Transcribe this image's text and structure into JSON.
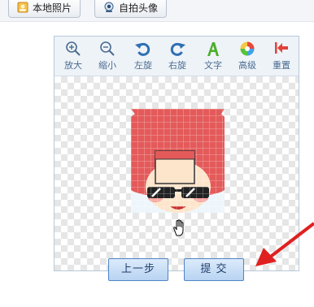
{
  "tabs": [
    {
      "label": "本地照片",
      "icon": "photo-icon"
    },
    {
      "label": "自拍头像",
      "icon": "webcam-icon"
    }
  ],
  "toolbar": {
    "zoom_in": "放大",
    "zoom_out": "缩小",
    "rotate_left": "左旋",
    "rotate_right": "右旋",
    "text": "文字",
    "advanced": "高级",
    "reset": "重置"
  },
  "actions": {
    "prev_label": "上一步",
    "submit_label": "提 交"
  },
  "colors": {
    "accent_blue": "#4a6b8f",
    "button_border": "#4f86c6",
    "annotation_arrow": "#e02020"
  }
}
